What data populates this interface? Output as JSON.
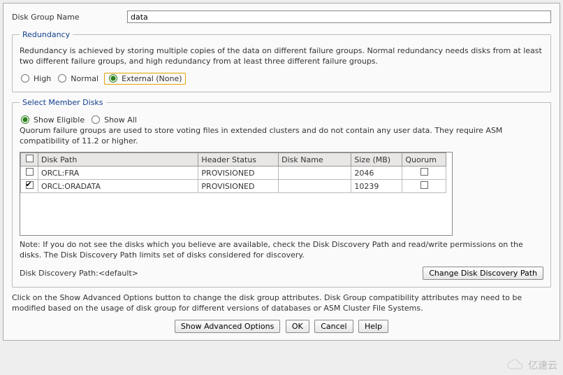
{
  "diskGroupName": {
    "label": "Disk Group Name",
    "value": "data"
  },
  "redundancy": {
    "legend": "Redundancy",
    "desc": "Redundancy is achieved by storing multiple copies of the data on different failure groups. Normal redundancy needs disks from at least two different failure groups, and high redundancy from at least three different failure groups.",
    "options": {
      "high": "High",
      "normal": "Normal",
      "external": "External (None)"
    },
    "selected": "external"
  },
  "memberDisks": {
    "legend": "Select Member Disks",
    "filterOptions": {
      "eligible": "Show Eligible",
      "all": "Show All"
    },
    "filterSelected": "eligible",
    "quorumDesc": "Quorum failure groups are used to store voting files in extended clusters and do not contain any user data. They require ASM compatibility of 11.2 or higher.",
    "columns": {
      "diskPath": "Disk Path",
      "headerStatus": "Header Status",
      "diskName": "Disk Name",
      "sizeMb": "Size (MB)",
      "quorum": "Quorum"
    },
    "rows": [
      {
        "selected": false,
        "diskPath": "ORCL:FRA",
        "headerStatus": "PROVISIONED",
        "diskName": "",
        "sizeMb": "2046",
        "quorum": false
      },
      {
        "selected": true,
        "diskPath": "ORCL:ORADATA",
        "headerStatus": "PROVISIONED",
        "diskName": "",
        "sizeMb": "10239",
        "quorum": false
      }
    ],
    "note": "Note: If you do not see the disks which you believe are available, check the Disk Discovery Path and read/write permissions on the disks. The Disk Discovery Path limits set of disks considered for discovery.",
    "discoveryLabel": "Disk Discovery Path:",
    "discoveryValue": "<default>",
    "changeBtn": "Change Disk Discovery Path"
  },
  "footer": {
    "desc": "Click on the Show Advanced Options button to change the disk group attributes. Disk Group compatibility attributes may need to be modified based on the usage of disk group for different versions of databases or ASM Cluster File Systems.",
    "buttons": {
      "advanced": "Show Advanced Options",
      "ok": "OK",
      "cancel": "Cancel",
      "help": "Help"
    }
  },
  "watermark": "亿速云"
}
